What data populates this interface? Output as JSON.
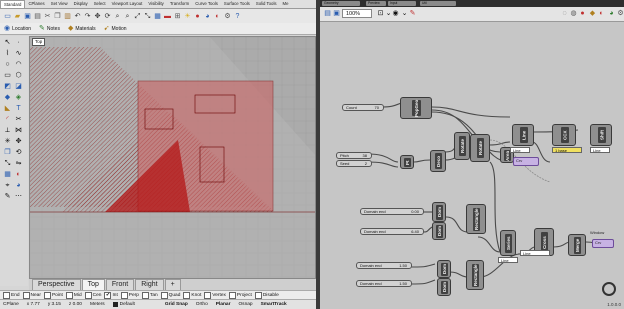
{
  "rhino": {
    "tabs": [
      "Standard",
      "CPlanes",
      "Set View",
      "Display",
      "Select",
      "Viewport Layout",
      "Visibility",
      "Transform",
      "Curve Tools",
      "Surface Tools",
      "Solid Tools",
      "Me"
    ],
    "active_tab": "Standard",
    "panel_tabs": [
      {
        "icon": "location-icon",
        "label": "Location"
      },
      {
        "icon": "notes-icon",
        "label": "Notes"
      },
      {
        "icon": "materials-icon",
        "label": "Materials"
      },
      {
        "icon": "motion-icon",
        "label": "Motion"
      }
    ],
    "viewport_label": "Top",
    "view_tabs": [
      "Perspective",
      "Top",
      "Front",
      "Right"
    ],
    "active_view": "Top",
    "add_view_label": "+",
    "osnaps": [
      {
        "label": "End",
        "checked": false
      },
      {
        "label": "Near",
        "checked": false
      },
      {
        "label": "Point",
        "checked": false
      },
      {
        "label": "Mid",
        "checked": false
      },
      {
        "label": "Cen",
        "checked": false
      },
      {
        "label": "Int",
        "checked": true
      },
      {
        "label": "Perp",
        "checked": false
      },
      {
        "label": "Tan",
        "checked": false
      },
      {
        "label": "Quad",
        "checked": false
      },
      {
        "label": "Knot",
        "checked": false
      },
      {
        "label": "Vertex",
        "checked": false
      },
      {
        "label": "Project",
        "checked": false
      },
      {
        "label": "Disable",
        "checked": false
      }
    ],
    "status": {
      "cplane": "CPlane",
      "x": "x 7.77",
      "y": "y 3.15",
      "z": "z 0.00",
      "units": "Meters",
      "layer": "Default",
      "grid_snap": "Grid Snap",
      "ortho": "Ortho",
      "planar": "Planar",
      "osnap": "Osnap",
      "smarttrack": "SmartTrack"
    }
  },
  "gh": {
    "menu": {
      "file": "Geometry",
      "preview": "Preview",
      "input": "Input",
      "util": "Util"
    },
    "zoom": "100%",
    "components": [
      {
        "label": "PopGeo"
      },
      {
        "label": "Line"
      },
      {
        "label": "CCX"
      },
      {
        "label": "Shift"
      },
      {
        "label": "Rotate"
      },
      {
        "label": "Rotate"
      },
      {
        "label": "Pt"
      },
      {
        "label": "Deco"
      },
      {
        "label": "Rectangle"
      },
      {
        "label": "Area"
      },
      {
        "label": "Dom"
      },
      {
        "label": "Dom"
      },
      {
        "label": "Bnds"
      },
      {
        "label": "Dom"
      },
      {
        "label": "Dom"
      },
      {
        "label": "Rectangle"
      },
      {
        "label": "Series"
      },
      {
        "label": "Cross"
      },
      {
        "label": "Flatten"
      },
      {
        "label": "Merge"
      }
    ],
    "sliders": [
      {
        "label": "Count",
        "value": "70"
      },
      {
        "label": "Pitch",
        "value": "38"
      },
      {
        "label": "Seed",
        "value": "2"
      },
      {
        "label": "Domain end",
        "value": "0.00"
      },
      {
        "label": "Domain end",
        "value": "6.40"
      },
      {
        "label": "Domain end",
        "value": "1.50"
      },
      {
        "label": "Domain end",
        "value": "1.50"
      }
    ],
    "panels": [
      {
        "text": "Line"
      },
      {
        "text": "Line"
      },
      {
        "text": "Line"
      },
      {
        "text": "1 base"
      },
      {
        "text": "Line"
      }
    ],
    "purple_labels": [
      "Crv",
      "Crv",
      "Window"
    ],
    "version": "1.0.0.0"
  }
}
